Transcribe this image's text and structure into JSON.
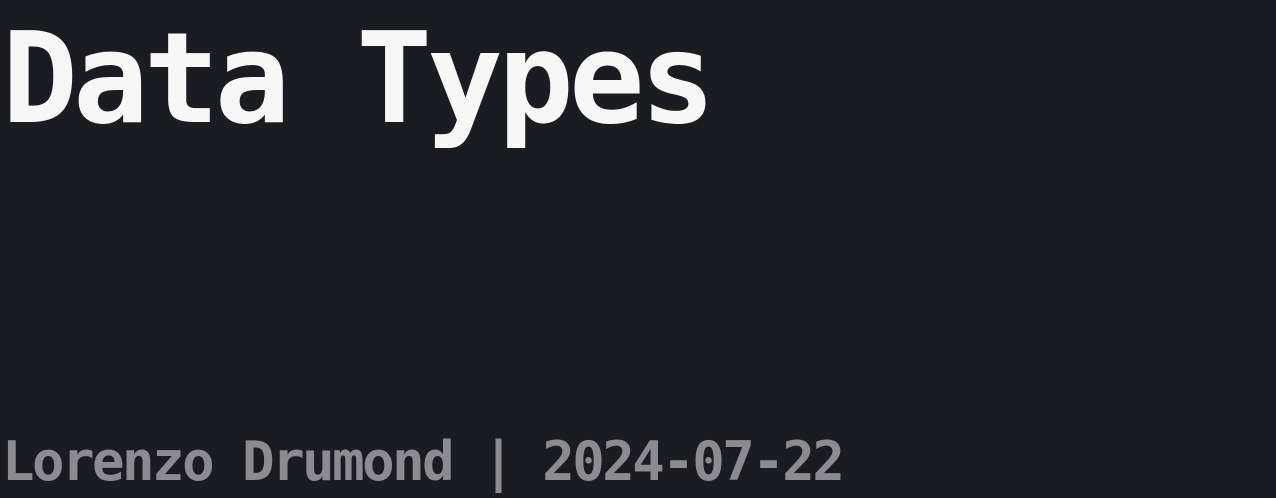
{
  "slide": {
    "title": "Data Types",
    "author": "Lorenzo Drumond",
    "separator": "|",
    "date": "2024-07-22"
  },
  "colors": {
    "background": "#1b1c21",
    "title": "#f7f7f7",
    "byline": "#8c8c90"
  }
}
